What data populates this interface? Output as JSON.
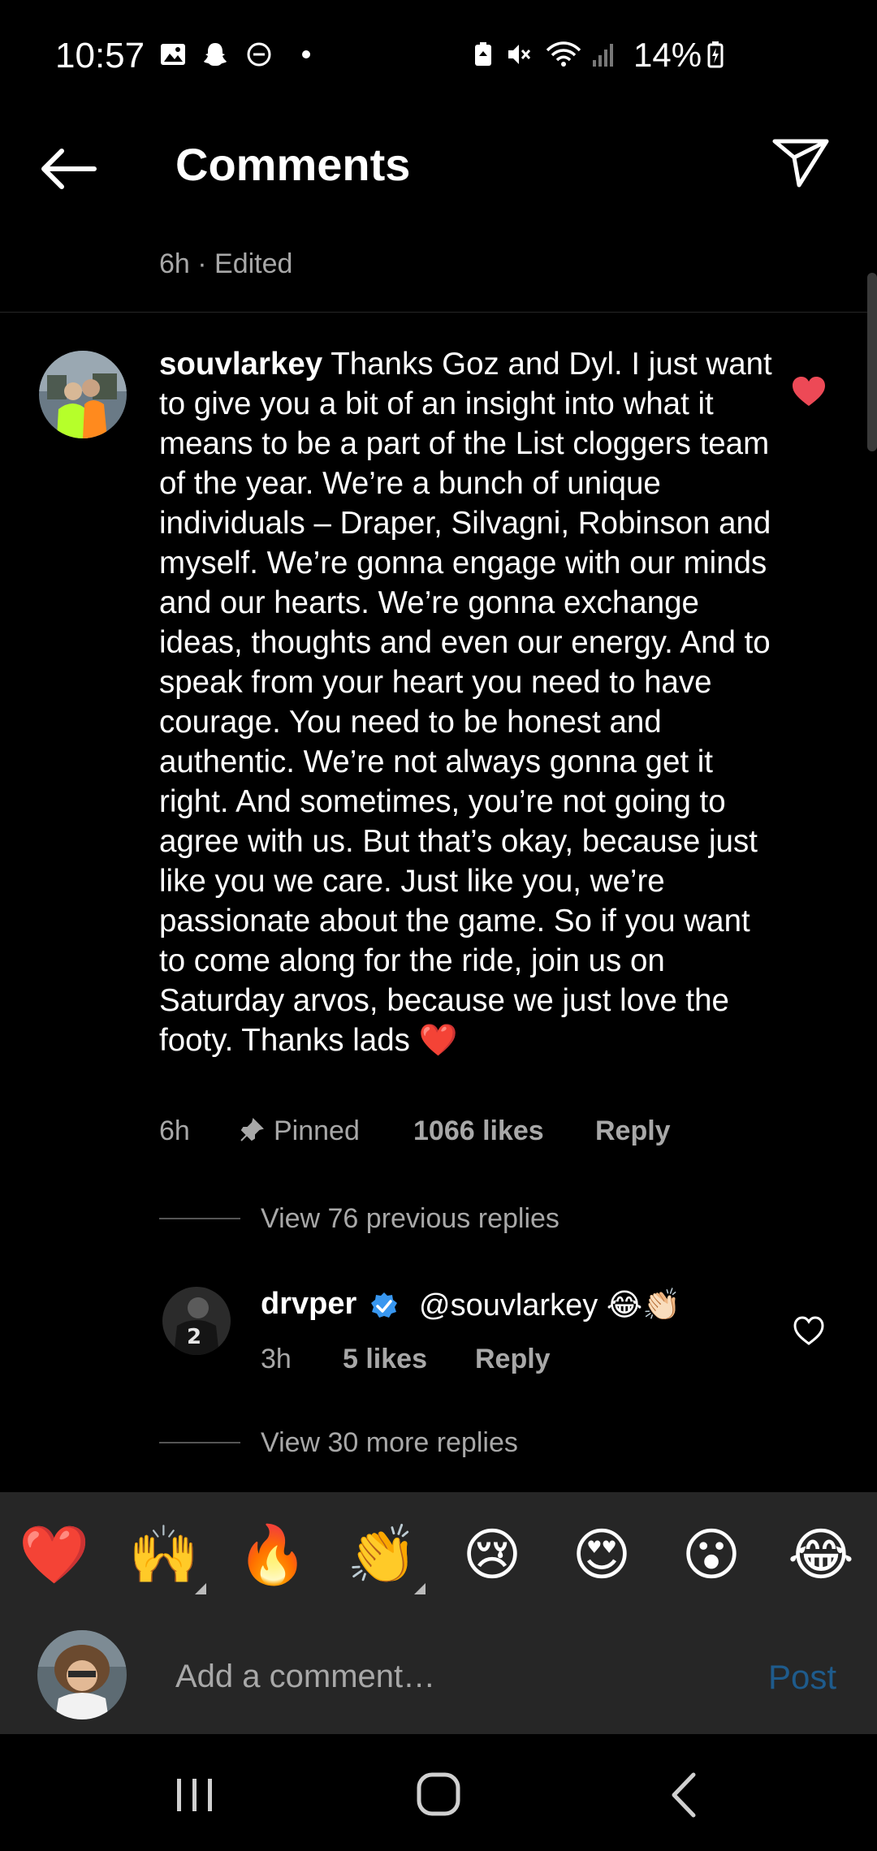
{
  "status_bar": {
    "time": "10:57",
    "battery": "14%",
    "left_icons": [
      "gallery-icon",
      "snapchat-icon",
      "dnd-icon",
      "dot-icon"
    ],
    "right_icons": [
      "battery-saver-icon",
      "mute-icon",
      "wifi-icon",
      "signal-icon",
      "battery-icon"
    ]
  },
  "header": {
    "title": "Comments",
    "back_icon": "back-arrow-icon",
    "send_icon": "send-icon"
  },
  "post_meta": "6h · Edited",
  "main_comment": {
    "username": "souvlarkey",
    "text": "Thanks Goz and Dyl. I just want to give you a bit of an insight into what it means to be a part of the List cloggers team of the year. We’re a bunch of unique individuals – Draper, Silvagni, Robinson and myself. We’re gonna engage with our minds and our hearts. We’re gonna exchange ideas, thoughts and even our energy. And to speak from your heart you need to have courage. You need to be honest and authentic. We’re not always gonna get it right. And sometimes, you’re not going to agree with us. But that’s okay, because just like you we care. Just like you, we’re passionate about the game. So if you want to come along for the ride, join us on Saturday arvos, because we just love the footy. Thanks lads",
    "emoji": "❤️",
    "time": "6h",
    "pinned": "Pinned",
    "likes": "1066 likes",
    "reply": "Reply",
    "liked": true
  },
  "view_previous": "View 76 previous replies",
  "reply": {
    "username": "drvper",
    "text": "@souvlarkey 😂👏🏻",
    "time": "3h",
    "likes": "5 likes",
    "reply": "Reply"
  },
  "view_more": "View 30 more replies",
  "emoji_bar": [
    "❤️",
    "🙌",
    "🔥",
    "👏",
    "😢",
    "😍",
    "😮",
    "😂"
  ],
  "composer": {
    "placeholder": "Add a comment…",
    "post": "Post"
  },
  "colors": {
    "background": "#000000",
    "panel": "#262626",
    "muted_text": "#a8a8a8",
    "like_red": "#ed4956",
    "verified_blue": "#3897f0",
    "post_blue": "#1e5b8c"
  }
}
